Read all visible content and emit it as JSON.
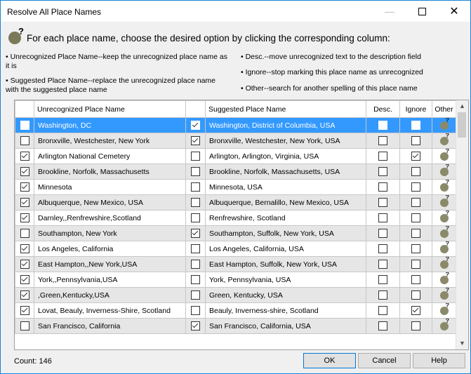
{
  "window": {
    "title": "Resolve All Place Names"
  },
  "header": {
    "icon": "globe-question-icon",
    "instruction": "For each place name, choose the desired option by clicking the corresponding column:"
  },
  "info": {
    "left1": "• Unrecognized Place Name--keep the unrecognized place name as it is",
    "left2": "• Suggested Place Name--replace the unrecognized place name with the suggested place name",
    "right1": "• Desc.--move unrecognized text to the description field",
    "right2": "• Ignore--stop marking this place name as unrecognized",
    "right3": "• Other--search for another spelling of this place name"
  },
  "grid": {
    "columns": {
      "unrecognized": "Unrecognized Place Name",
      "suggested": "Suggested Place Name",
      "desc": "Desc.",
      "ignore": "Ignore",
      "other": "Other"
    },
    "rows": [
      {
        "keep": false,
        "unrecognized": "Washington, DC",
        "use_suggested": true,
        "suggested": "Washington, District of Columbia, USA",
        "desc": false,
        "ignore": false
      },
      {
        "keep": false,
        "unrecognized": "Bronxville, Westchester, New York",
        "use_suggested": true,
        "suggested": "Bronxville, Westchester, New York, USA",
        "desc": false,
        "ignore": false
      },
      {
        "keep": true,
        "unrecognized": "Arlington National Cemetery",
        "use_suggested": false,
        "suggested": "Arlington, Arlington, Virginia, USA",
        "desc": false,
        "ignore": true
      },
      {
        "keep": true,
        "unrecognized": "Brookline, Norfolk, Massachusetts",
        "use_suggested": false,
        "suggested": "Brookline, Norfolk, Massachusetts, USA",
        "desc": false,
        "ignore": false
      },
      {
        "keep": true,
        "unrecognized": "Minnesota",
        "use_suggested": false,
        "suggested": "Minnesota, USA",
        "desc": false,
        "ignore": false
      },
      {
        "keep": true,
        "unrecognized": "Albuquerque, New Mexico, USA",
        "use_suggested": false,
        "suggested": "Albuquerque, Bernalillo, New Mexico, USA",
        "desc": false,
        "ignore": false
      },
      {
        "keep": true,
        "unrecognized": "Darnley,,Renfrewshire,Scotland",
        "use_suggested": false,
        "suggested": "Renfrewshire, Scotland",
        "desc": false,
        "ignore": false
      },
      {
        "keep": false,
        "unrecognized": "Southampton, New York",
        "use_suggested": true,
        "suggested": "Southampton, Suffolk, New York, USA",
        "desc": false,
        "ignore": false
      },
      {
        "keep": true,
        "unrecognized": "Los Angeles, California",
        "use_suggested": false,
        "suggested": "Los Angeles, California, USA",
        "desc": false,
        "ignore": false
      },
      {
        "keep": true,
        "unrecognized": "East Hampton,,New York,USA",
        "use_suggested": false,
        "suggested": "East Hampton, Suffolk, New York, USA",
        "desc": false,
        "ignore": false
      },
      {
        "keep": true,
        "unrecognized": "York,,Pennsylvania,USA",
        "use_suggested": false,
        "suggested": "York, Pennsylvania, USA",
        "desc": false,
        "ignore": false
      },
      {
        "keep": true,
        "unrecognized": ",Green,Kentucky,USA",
        "use_suggested": false,
        "suggested": "Green, Kentucky, USA",
        "desc": false,
        "ignore": false
      },
      {
        "keep": true,
        "unrecognized": "Lovat, Beauly, Inverness-Shire, Scotland",
        "use_suggested": false,
        "suggested": "Beauly, Inverness-shire, Scotland",
        "desc": false,
        "ignore": true
      },
      {
        "keep": false,
        "unrecognized": "San Francisco, California",
        "use_suggested": true,
        "suggested": "San Francisco, California, USA",
        "desc": false,
        "ignore": false
      }
    ]
  },
  "footer": {
    "count": "Count:  146",
    "ok": "OK",
    "cancel": "Cancel",
    "help": "Help"
  }
}
